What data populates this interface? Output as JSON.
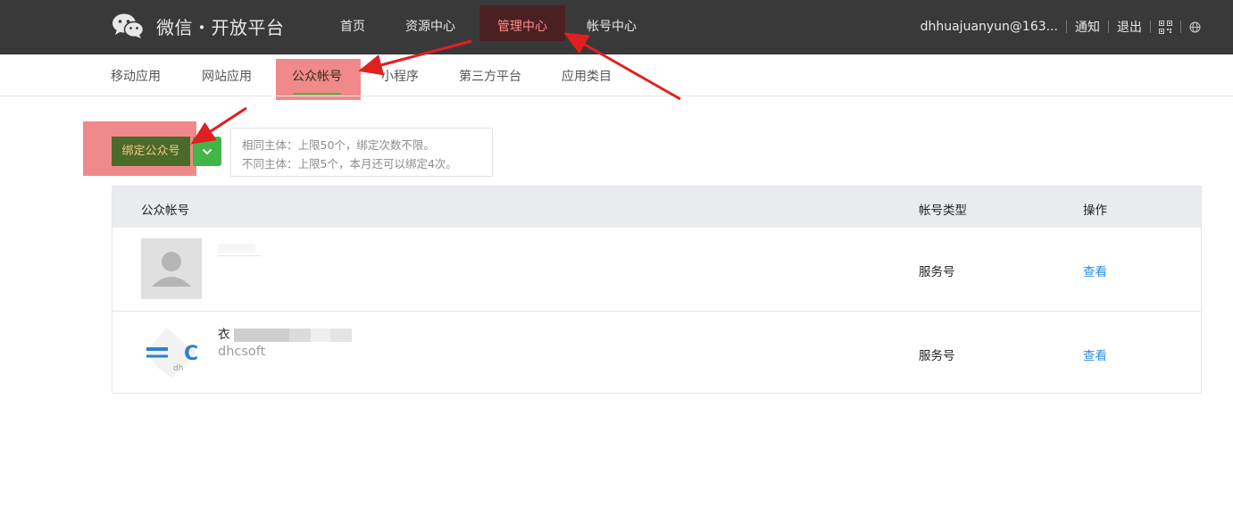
{
  "header": {
    "logo_text": "微信・开放平台",
    "nav": [
      {
        "label": "首页"
      },
      {
        "label": "资源中心"
      },
      {
        "label": "管理中心"
      },
      {
        "label": "帐号中心"
      }
    ],
    "user": "dhhuajuanyun@163...",
    "notify": "通知",
    "logout": "退出"
  },
  "subnav": [
    {
      "label": "移动应用"
    },
    {
      "label": "网站应用"
    },
    {
      "label": "公众帐号"
    },
    {
      "label": "小程序"
    },
    {
      "label": "第三方平台"
    },
    {
      "label": "应用类目"
    }
  ],
  "bind": {
    "button_label": "绑定公众号",
    "tip_line1": "相同主体：上限50个，绑定次数不限。",
    "tip_line2": "不同主体：上限5个，本月还可以绑定4次。"
  },
  "table": {
    "headers": {
      "account": "公众帐号",
      "type": "帐号类型",
      "action": "操作"
    },
    "rows": [
      {
        "name": "",
        "sub": "",
        "type": "服务号",
        "action": "查看"
      },
      {
        "name": "衣",
        "sub": "dhcsoft",
        "type": "服务号",
        "action": "查看"
      }
    ]
  },
  "colors": {
    "topbar": "#393939",
    "active_nav": "#4a2123",
    "highlight": "#f08a8a",
    "green": "#44b549",
    "link": "#2e8de6",
    "annotation_arrow": "#e02020"
  }
}
